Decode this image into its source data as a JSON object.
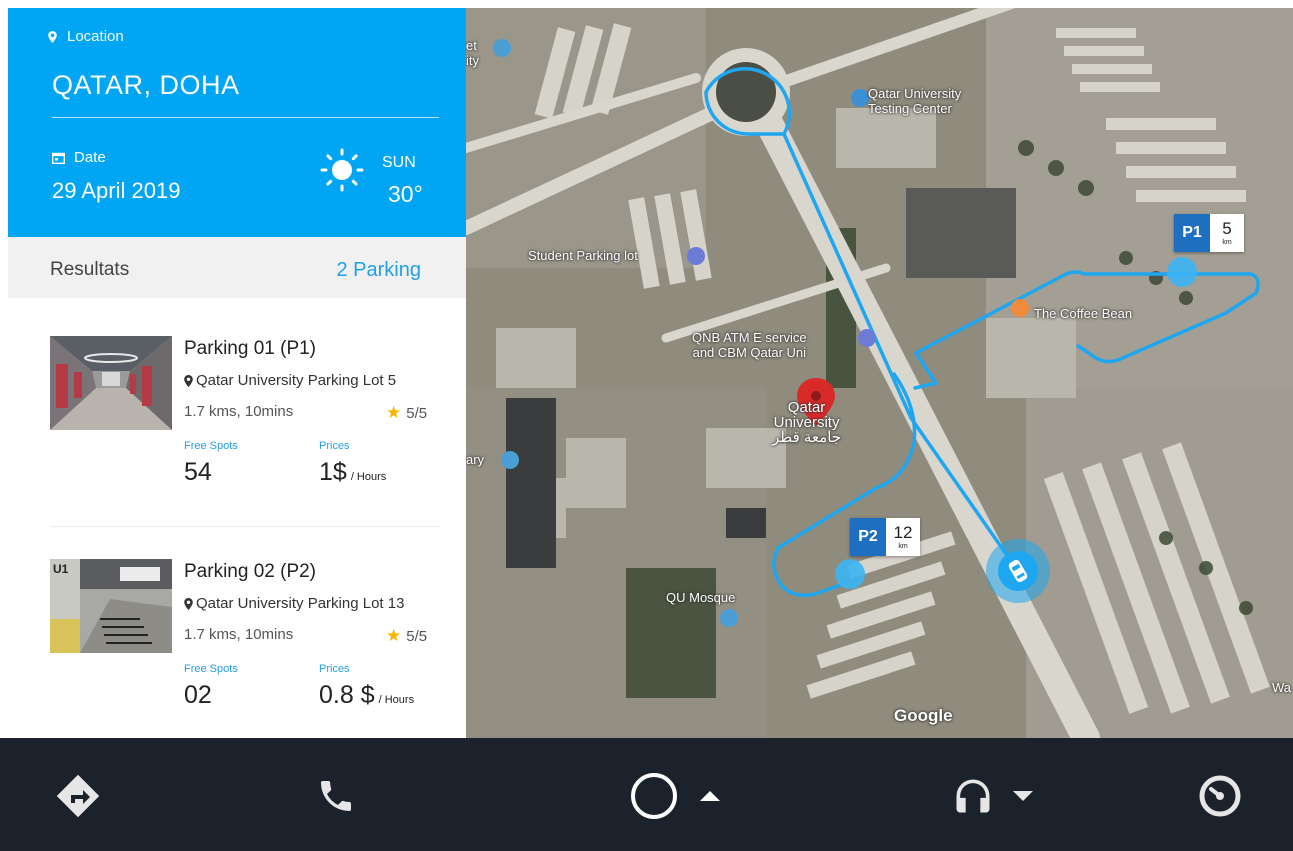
{
  "header": {
    "location_label": "Location",
    "city": "QATAR, DOHA",
    "date_label": "Date",
    "date": "29 April 2019",
    "weather_day": "SUN",
    "weather_temp": "30°"
  },
  "results": {
    "label": "Resultats",
    "count": "2 Parking"
  },
  "parkings": [
    {
      "name": "Parking 01 (P1)",
      "address": "Qatar University Parking Lot 5",
      "distance_time": "1.7 kms, 10mins",
      "rating": "5/5",
      "free_spots_label": "Free Spots",
      "free_spots": "54",
      "prices_label": "Prices",
      "price": "1$",
      "price_unit": "/ Hours"
    },
    {
      "name": "Parking 02 (P2)",
      "address": "Qatar University Parking Lot 13",
      "distance_time": "1.7 kms, 10mins",
      "rating": "5/5",
      "free_spots_label": "Free Spots",
      "free_spots": "02",
      "prices_label": "Prices",
      "price": "0.8 $",
      "price_unit": "/ Hours",
      "thumb_sign": "U1"
    }
  ],
  "map": {
    "labels": {
      "qu_testing": "Qatar University\nTesting Center",
      "student_parking": "Student Parking lot",
      "qnb_atm": "QNB ATM E service\nand CBM Qatar Uni",
      "qatar_univ": "Qatar\nUniversity\nجامعة قطر",
      "coffee_bean": "The Coffee Bean",
      "qu_mosque": "QU Mosque",
      "library_edge": "ary",
      "top_left_edge": "et\nity",
      "right_edge": "Wa",
      "google": "Google"
    },
    "badges": [
      {
        "code": "P1",
        "distance": "5",
        "unit": "km"
      },
      {
        "code": "P2",
        "distance": "12",
        "unit": "km"
      }
    ]
  },
  "colors": {
    "accent": "#00a5f3",
    "route": "#1ea7f0",
    "badge": "#1f6fc0",
    "navbar": "#1c222c",
    "star": "#f5b400"
  },
  "icons": {
    "location": "location-pin-icon",
    "date": "calendar-icon",
    "weather": "sun-icon",
    "nav": [
      "directions-icon",
      "phone-icon",
      "home-circle-icon",
      "headphones-icon",
      "speedometer-icon"
    ]
  }
}
